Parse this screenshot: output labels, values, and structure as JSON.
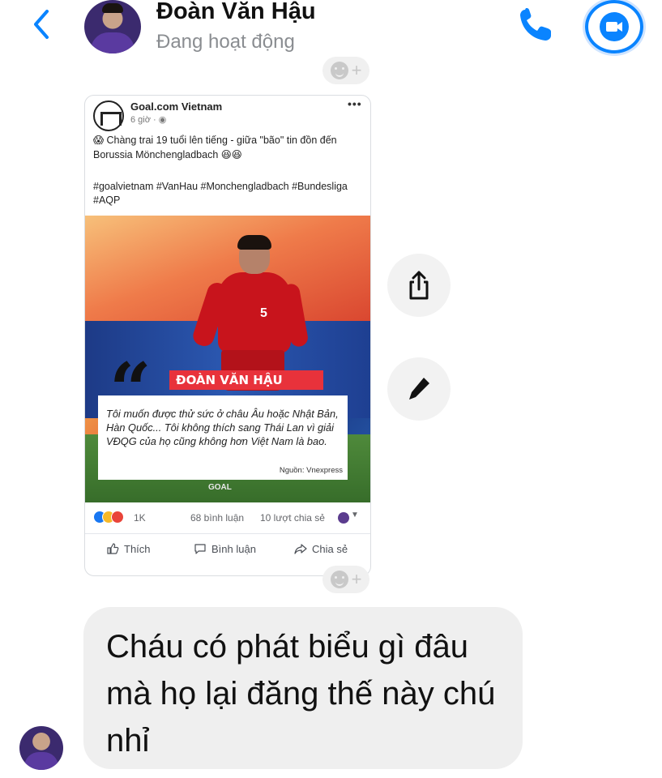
{
  "header": {
    "contact_name": "Đoàn Văn Hậu",
    "status": "Đang hoạt động",
    "back_icon": "chevron-left-icon",
    "call_icon": "phone-icon",
    "video_icon": "video-camera-icon",
    "accent_color": "#0a84ff"
  },
  "shared_post": {
    "page_name": "Goal.com Vietnam",
    "time": "6 giờ · ",
    "text": "😱 Chàng trai 19 tuổi lên tiếng - giữa \"bão\" tin đồn đến Borussia Mönchengladbach 😆😆",
    "hashtags": "#goalvietnam #VanHau #Monchengladbach #Bundesliga #AQP",
    "image": {
      "banner_name": "ĐOÀN VĂN HẬU",
      "quote": "Tôi muốn được thử sức ở châu Âu hoặc Nhật Bản, Hàn Quốc... Tôi không thích sang Thái Lan vì giải VĐQG của họ cũng không hơn Việt Nam là bao.",
      "source": "Nguồn: Vnexpress",
      "jersey_number": "5",
      "watermark": "GOAL"
    },
    "reactions": {
      "count": "1K",
      "comments": "68 bình luận",
      "shares": "10 lượt chia sẻ"
    },
    "actions": {
      "like": "Thích",
      "comment": "Bình luận",
      "share": "Chia sẻ"
    }
  },
  "side_actions": {
    "share_icon": "share-icon",
    "edit_icon": "pencil-icon"
  },
  "message": {
    "text": "Cháu có phát biểu gì đâu mà họ lại đăng thế này chú nhỉ"
  },
  "reaction_add": {
    "label": "+"
  }
}
